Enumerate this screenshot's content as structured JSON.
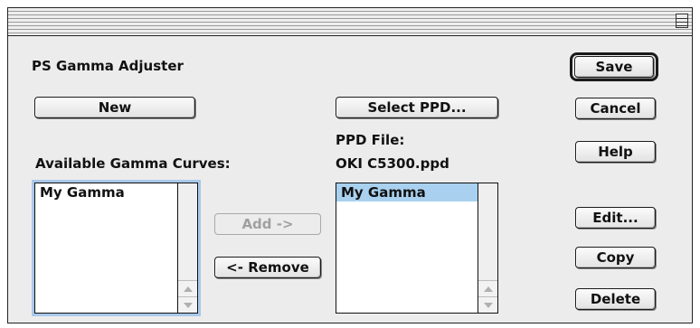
{
  "dialog": {
    "title_label": "PS Gamma Adjuster"
  },
  "buttons": {
    "new": "New",
    "select_ppd": "Select PPD...",
    "save": "Save",
    "cancel": "Cancel",
    "help": "Help",
    "add": "Add ->",
    "remove": "<- Remove",
    "edit": "Edit...",
    "copy": "Copy",
    "delete": "Delete"
  },
  "available": {
    "label": "Available Gamma Curves:",
    "items": [
      "My Gamma"
    ]
  },
  "ppd": {
    "label": "PPD File:",
    "filename": "OKI C5300.ppd",
    "items": [
      "My Gamma"
    ],
    "selected_index": 0
  },
  "icons": {
    "window_collapse": "collapse-box-icon",
    "scroll_up": "scroll-up-arrow-icon",
    "scroll_down": "scroll-down-arrow-icon"
  },
  "colors": {
    "selection": "#a9d1ef",
    "focus_ring": "#a9c8ea",
    "disabled_text": "#a0a0a0"
  }
}
